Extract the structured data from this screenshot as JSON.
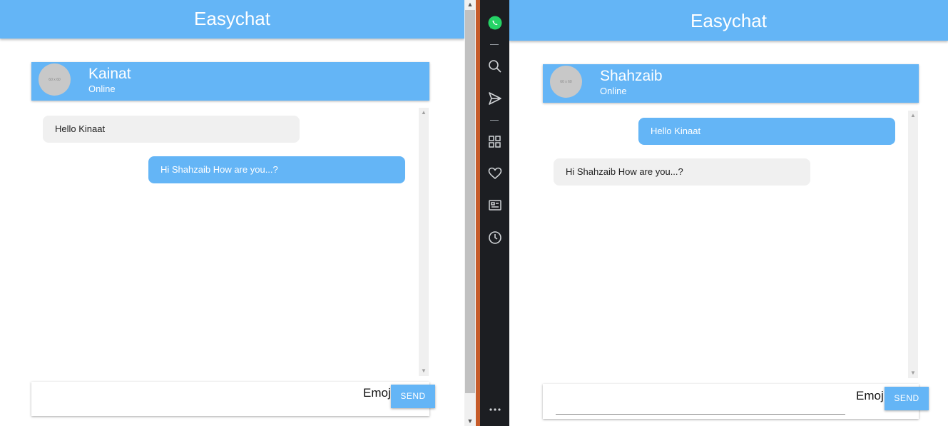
{
  "left": {
    "app_title": "Easychat",
    "contact": {
      "name": "Kainat",
      "status": "Online",
      "avatar_placeholder": "60 x 60"
    },
    "messages": [
      {
        "text": "Hello Kinaat",
        "direction": "incoming"
      },
      {
        "text": "Hi Shahzaib How are you...?",
        "direction": "outgoing"
      }
    ],
    "composer": {
      "value": "",
      "placeholder": "",
      "emoji_label": "Emoj",
      "send_label": "SEND"
    }
  },
  "right": {
    "app_title": "Easychat",
    "contact": {
      "name": "Shahzaib",
      "status": "Online",
      "avatar_placeholder": "60 x 60"
    },
    "messages": [
      {
        "text": "Hello Kinaat",
        "direction": "outgoing"
      },
      {
        "text": "Hi Shahzaib How are you...?",
        "direction": "incoming"
      }
    ],
    "composer": {
      "value": "",
      "placeholder": "",
      "emoji_label": "Emoj",
      "send_label": "SEND"
    }
  },
  "sidebar": {
    "icons": [
      "whatsapp-icon",
      "search-icon",
      "send-icon",
      "apps-icon",
      "heart-icon",
      "news-icon",
      "clock-icon",
      "more-icon"
    ]
  },
  "colors": {
    "primary": "#64b5f6",
    "incoming_bubble": "#f0f0f0",
    "sidebar_bg": "#1c1e22",
    "accent": "#c65b29",
    "whatsapp": "#25d366"
  }
}
